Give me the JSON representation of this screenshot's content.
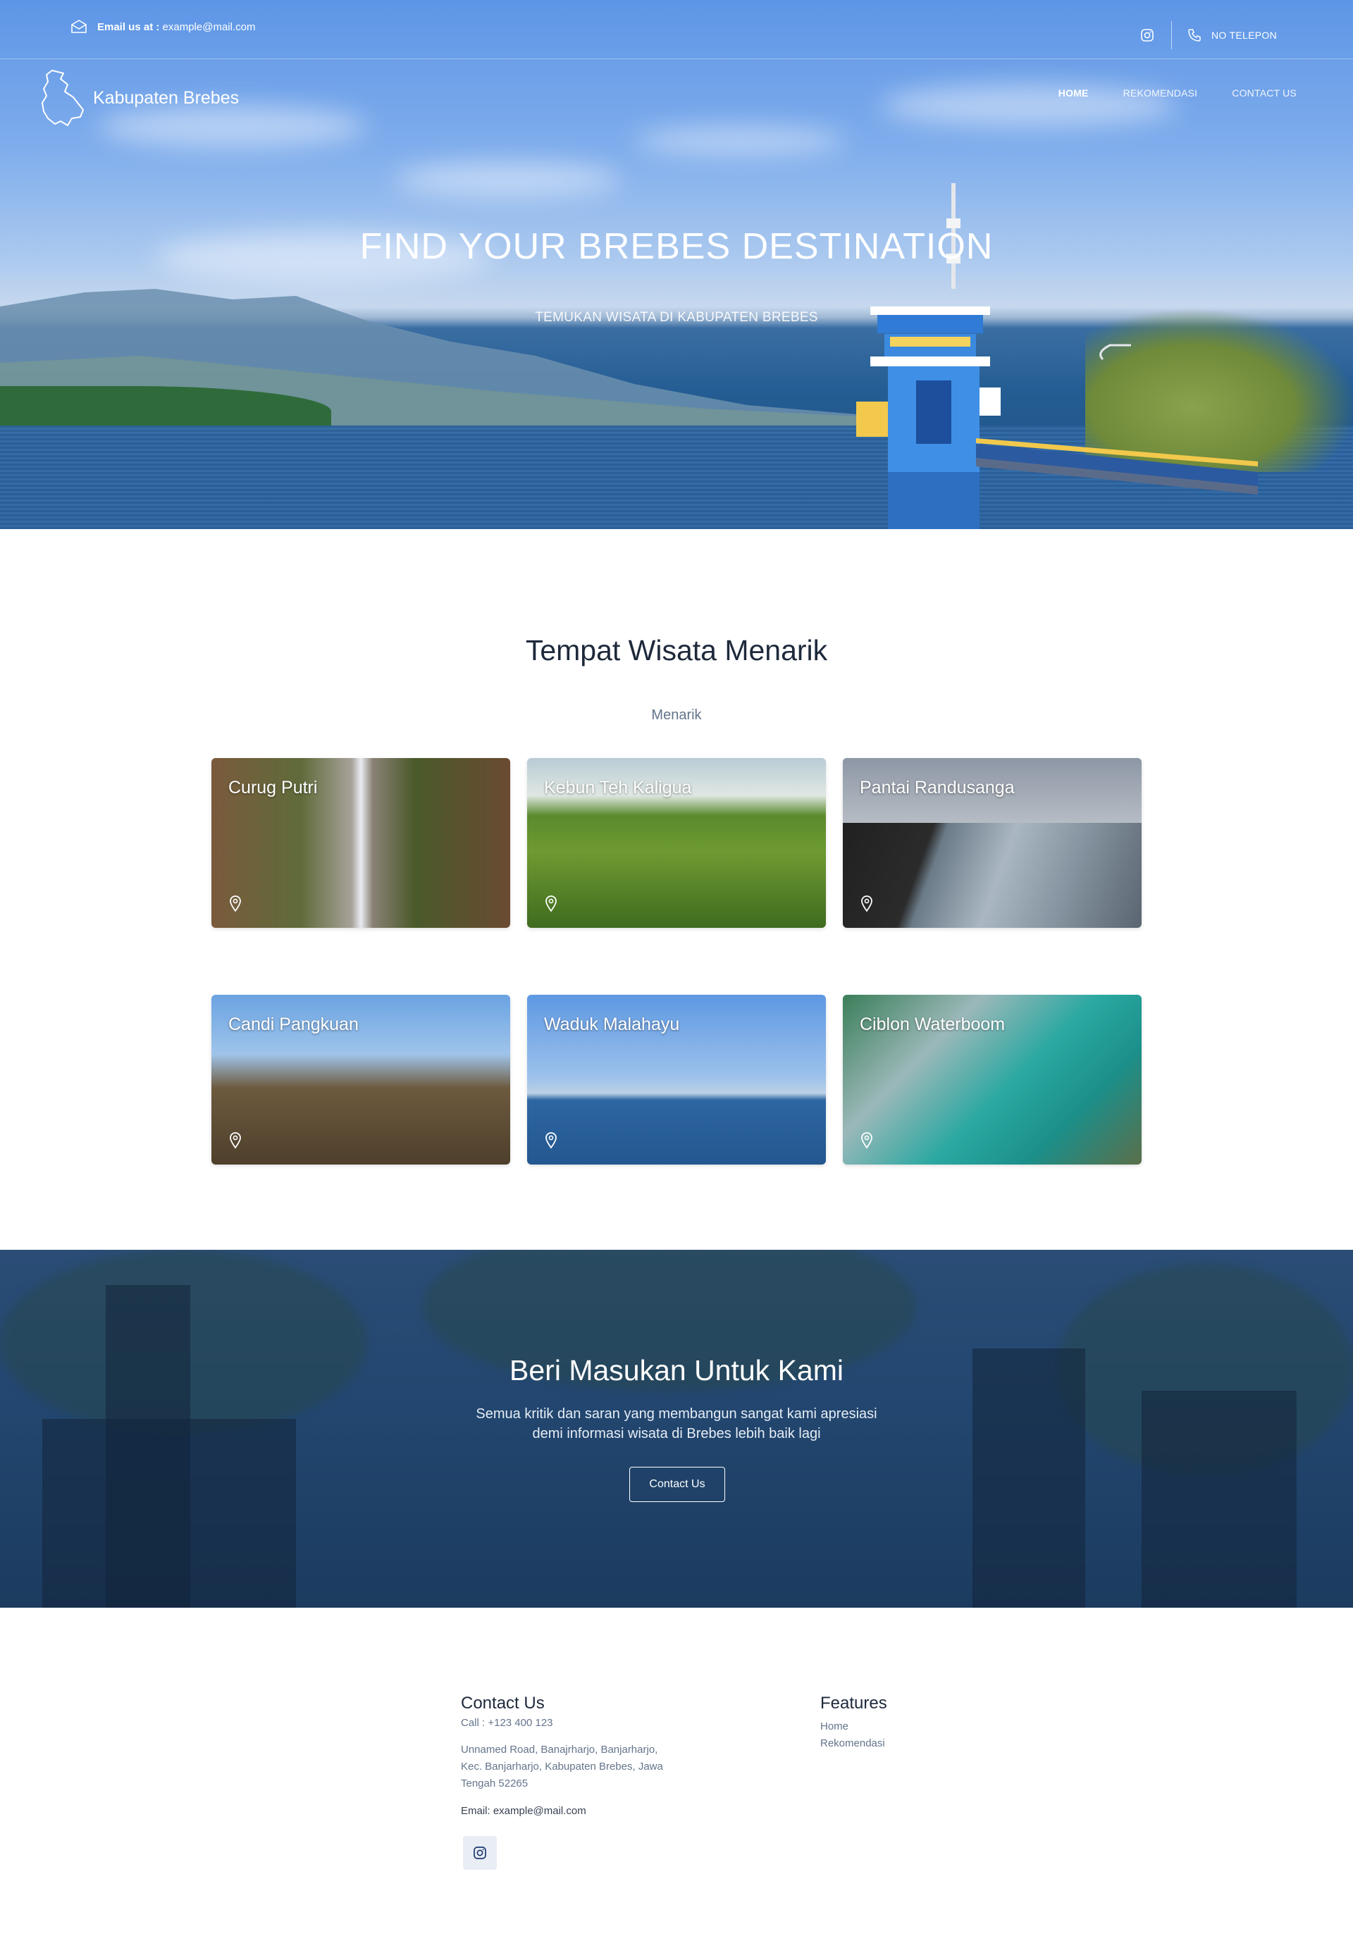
{
  "topbar": {
    "email_label": "Email us at :",
    "email_value": "example@mail.com",
    "phone_label": "NO TELEPON",
    "icons": [
      "mail-icon",
      "instagram-icon",
      "phone-icon"
    ]
  },
  "brand": {
    "name": "Kabupaten Brebes",
    "logo_icon": "map-outline-icon"
  },
  "nav": {
    "items": [
      {
        "label": "HOME",
        "active": true
      },
      {
        "label": "REKOMENDASI",
        "active": false
      },
      {
        "label": "CONTACT US",
        "active": false
      }
    ]
  },
  "hero": {
    "title": "FIND YOUR BREBES DESTINATION",
    "subtitle": "TEMUKAN WISATA DI KABUPATEN BREBES"
  },
  "attractions": {
    "title": "Tempat Wisata Menarik",
    "subtitle": "Menarik",
    "cards": [
      {
        "title": "Curug Putri",
        "icon": "location-pin-icon"
      },
      {
        "title": "Kebun Teh Kaligua",
        "icon": "location-pin-icon"
      },
      {
        "title": "Pantai Randusanga",
        "icon": "location-pin-icon"
      },
      {
        "title": "Candi Pangkuan",
        "icon": "location-pin-icon"
      },
      {
        "title": "Waduk Malahayu",
        "icon": "location-pin-icon"
      },
      {
        "title": "Ciblon Waterboom",
        "icon": "location-pin-icon"
      }
    ]
  },
  "feedback": {
    "title": "Beri Masukan Untuk Kami",
    "line1": "Semua kritik dan saran yang membangun sangat kami apresiasi",
    "line2": "demi informasi wisata di Brebes lebih baik lagi",
    "button": "Contact Us"
  },
  "footer": {
    "contact": {
      "title": "Contact Us",
      "call": "Call : +123 400 123",
      "address_lines": [
        "Unnamed Road, Banajrharjo, Banjarharjo,",
        "Kec. Banjarharjo, Kabupaten Brebes, Jawa",
        "Tengah 52265"
      ],
      "email": "Email: example@mail.com",
      "social_icon": "instagram-icon"
    },
    "features": {
      "title": "Features",
      "links": [
        "Home",
        "Rekomendasi"
      ]
    }
  },
  "colors": {
    "text_dark": "#1e293b",
    "text_muted": "#64748b",
    "banner_overlay": "#22466f",
    "hero_sky": "#7fadec"
  }
}
